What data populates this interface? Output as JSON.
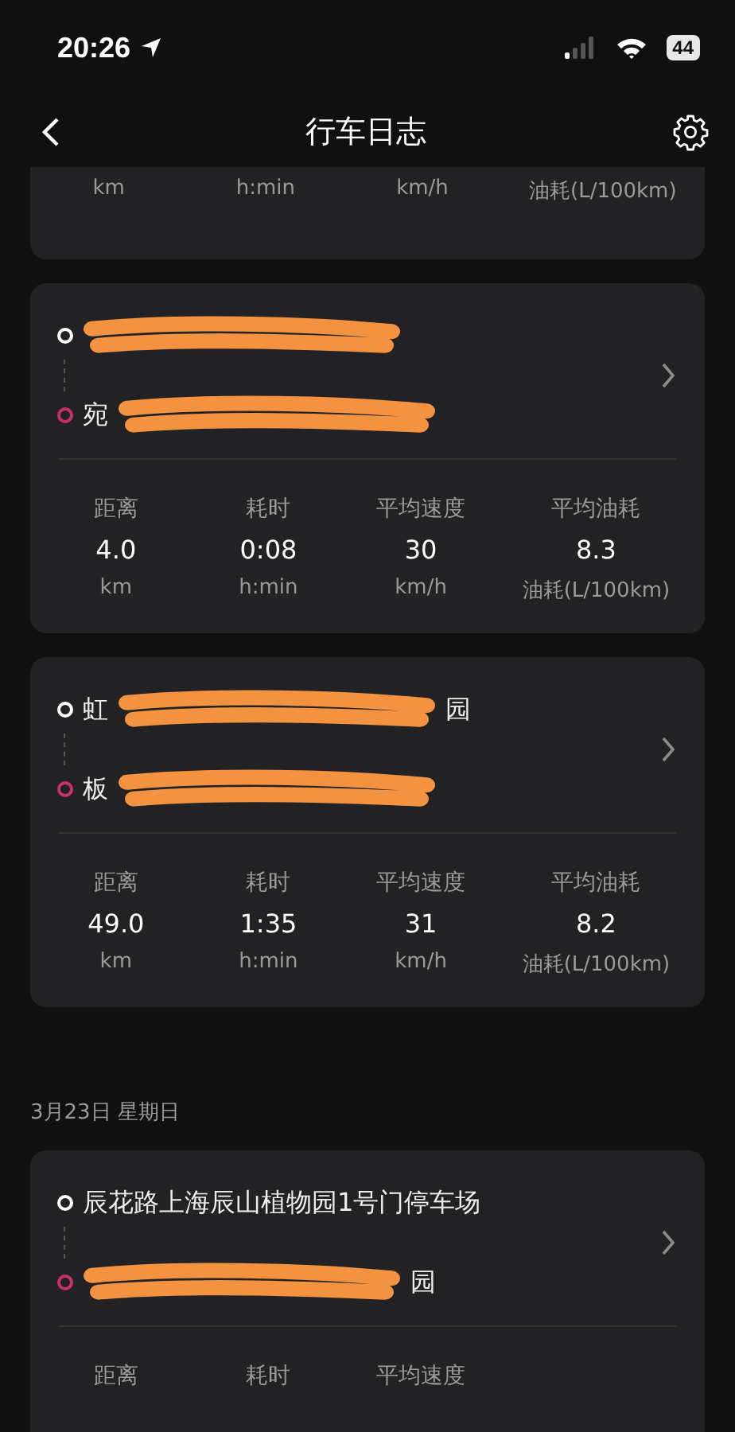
{
  "status_bar": {
    "time": "20:26",
    "battery": "44"
  },
  "nav": {
    "title": "行车日志"
  },
  "partial_card": {
    "units": [
      "km",
      "h:min",
      "km/h",
      "油耗(L/100km)"
    ]
  },
  "trips": [
    {
      "origin": [
        {
          "kind": "scribble"
        }
      ],
      "destination": [
        {
          "kind": "text",
          "text": "宛"
        },
        {
          "kind": "scribble"
        }
      ],
      "stats": [
        {
          "label": "距离",
          "value": "4.0",
          "unit": "km"
        },
        {
          "label": "耗时",
          "value": "0:08",
          "unit": "h:min"
        },
        {
          "label": "平均速度",
          "value": "30",
          "unit": "km/h"
        },
        {
          "label": "平均油耗",
          "value": "8.3",
          "unit": "油耗(L/100km)"
        }
      ]
    },
    {
      "origin": [
        {
          "kind": "text",
          "text": "虹"
        },
        {
          "kind": "scribble"
        },
        {
          "kind": "text",
          "text": "园"
        }
      ],
      "destination": [
        {
          "kind": "text",
          "text": "板"
        },
        {
          "kind": "scribble"
        }
      ],
      "stats": [
        {
          "label": "距离",
          "value": "49.0",
          "unit": "km"
        },
        {
          "label": "耗时",
          "value": "1:35",
          "unit": "h:min"
        },
        {
          "label": "平均速度",
          "value": "31",
          "unit": "km/h"
        },
        {
          "label": "平均油耗",
          "value": "8.2",
          "unit": "油耗(L/100km)"
        }
      ]
    }
  ],
  "date_header": "3月23日 星期日",
  "last_trip": {
    "origin": [
      {
        "kind": "text",
        "text": "辰花路上海辰山植物园1号门停车场"
      }
    ],
    "destination": [
      {
        "kind": "scribble"
      },
      {
        "kind": "text",
        "text": "园"
      }
    ],
    "stats": [
      {
        "label": "距离"
      },
      {
        "label": "耗时"
      },
      {
        "label": "平均速度"
      }
    ]
  }
}
